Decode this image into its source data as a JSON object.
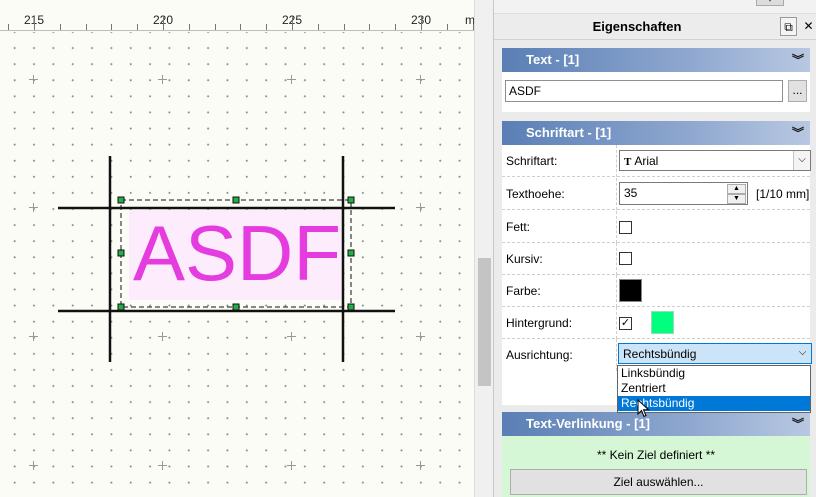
{
  "ruler": {
    "labels": [
      "215",
      "220",
      "225",
      "230"
    ],
    "unit": "mm"
  },
  "drawing": {
    "text": "ASDF",
    "text_color": "#e53ce0",
    "background_color": "#fcecfc"
  },
  "panel": {
    "title": "Eigenschaften",
    "pin_icon": "pin-icon",
    "close_icon": "close-icon"
  },
  "text_section": {
    "header": "Text  -  [1]",
    "value": "ASDF",
    "browse_label": "..."
  },
  "font_section": {
    "header": "Schriftart  -  [1]",
    "rows": {
      "font_label": "Schriftart:",
      "font_value": "Arial",
      "font_icon": "truetype-icon",
      "height_label": "Texthoehe:",
      "height_value": "35",
      "height_unit": "[1/10 mm]",
      "bold_label": "Fett:",
      "bold_checked": false,
      "italic_label": "Kursiv:",
      "italic_checked": false,
      "color_label": "Farbe:",
      "color_value": "#000000",
      "bg_label": "Hintergrund:",
      "bg_checked": true,
      "bg_color": "#00ff7f",
      "align_label": "Ausrichtung:",
      "align_value": "Rechtsbündig",
      "align_options": [
        "Linksbündig",
        "Zentriert",
        "Rechtsbündig"
      ],
      "align_highlighted": "Rechtsbündig"
    }
  },
  "link_section": {
    "header": "Text-Verlinkung  -  [1]",
    "no_target": "** Kein Ziel definiert **",
    "select_button": "Ziel auswählen..."
  },
  "colors": {
    "section_header": "#5a7fb5",
    "selection_blue": "#0078d7",
    "link_body": "#d6f7d6"
  }
}
